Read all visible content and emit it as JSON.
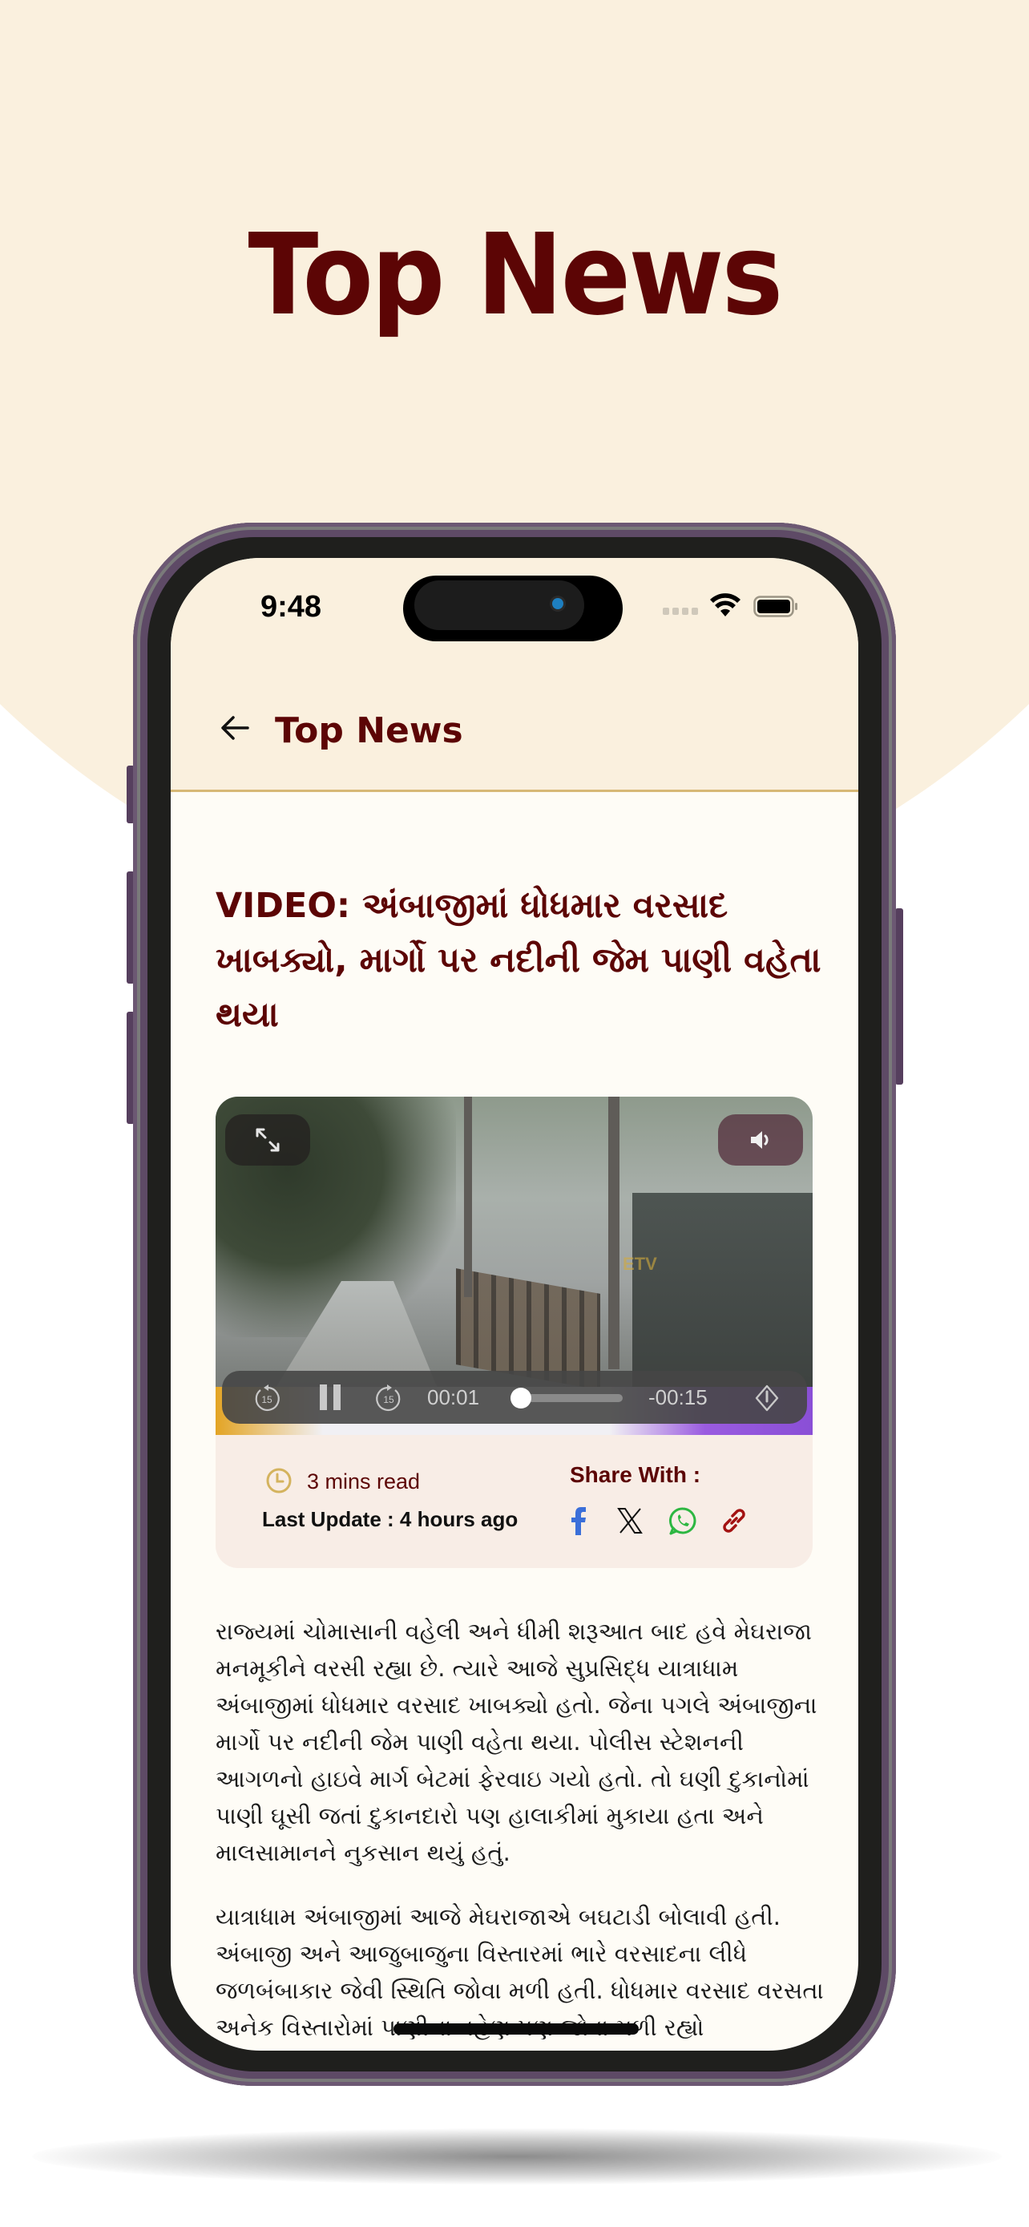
{
  "promo": {
    "title": "Top News"
  },
  "status_bar": {
    "time": "9:48"
  },
  "app_bar": {
    "title": "Top News",
    "back_icon": "arrow-left-icon"
  },
  "article": {
    "headline": "VIDEO: અંબાજીમાં ધોધમાર વરસાદ ખાબક્યો, માર્ગો પર નદીની જેમ પાણી વહેતા થયા",
    "video": {
      "watermark": "ETV",
      "expand_icon": "expand-icon",
      "mute_icon": "speaker-icon",
      "current_time": "00:01",
      "remaining_time": "-00:15",
      "progress": 0.06,
      "skip_back_label": "15",
      "skip_forward_label": "15",
      "state": "playing"
    },
    "meta": {
      "read_time": "3 mins read",
      "last_update": "Last Update : 4 hours ago",
      "share_label": "Share With :",
      "share_targets": [
        {
          "name": "facebook",
          "color": "#3B6FD9"
        },
        {
          "name": "x",
          "color": "#111111"
        },
        {
          "name": "whatsapp",
          "color": "#2DB742"
        },
        {
          "name": "copy-link",
          "color": "#A31212"
        }
      ]
    },
    "paragraphs": [
      "રાજ્યમાં ચોમાસાની વહેલી અને ધીમી શરૂઆત બાદ હવે મેઘરાજા મનમૂકીને વરસી રહ્યા છે. ત્યારે આજે સુપ્રસિદ્ધ યાત્રાધામ અંબાજીમાં ધોધમાર વરસાદ ખાબક્યો હતો. જેના પગલે અંબાજીના માર્ગો પર નદીની જેમ પાણી વહેતા થયા. પોલીસ સ્ટેશનની આગળનો હાઇવે માર્ગ બેટમાં ફેરવાઇ ગયો હતો. તો ઘણી દુકાનોમાં પાણી ઘૂસી જતાં દુકાનદારો પણ હાલાકીમાં મુકાયા હતા અને માલસામાનને નુકસાન થયું હતું.",
      "યાત્રાધામ અંબાજીમાં આજે મેઘરાજાએ બઘટાડી બોલાવી હતી. અંબાજી અને આજુબાજુના વિસ્તારમાં ભારે વરસાદના લીધે જળબંબાકાર જેવી સ્થિતિ જોવા મળી હતી. ધોધમાર વરસાદ વરસતા અનેક વિસ્તારોમાં પાણીના વહેણ પણ જોવા મળી રહ્યો"
    ]
  },
  "colors": {
    "brand": "#5C0505",
    "cream": "#FAF0DE",
    "accent_line": "#D7B876",
    "clock": "#D4B35E"
  }
}
